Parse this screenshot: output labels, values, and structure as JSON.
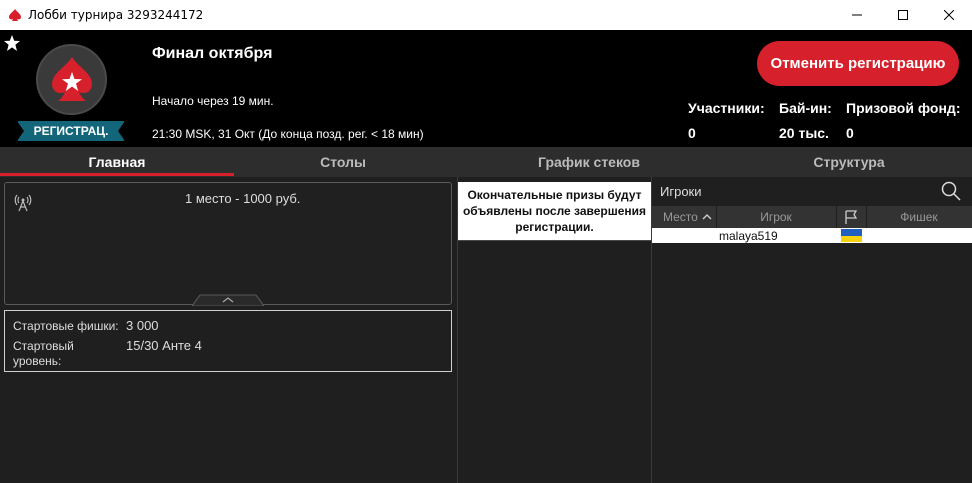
{
  "window": {
    "title": "Лобби турнира 3293244172"
  },
  "header": {
    "status_banner": "РЕГИСТРАЦ.",
    "tournament_name": "Финал октября",
    "starts_in": "Начало через 19 мин.",
    "schedule": "21:30 MSK, 31 Окт (До конца позд. рег. < 18 мин)",
    "cancel_button": "Отменить регистрацию",
    "stats": {
      "players_label": "Участники:",
      "players_value": "0",
      "buyin_label": "Бай-ин:",
      "buyin_value": "20 тыс.",
      "prizepool_label": "Призовой фонд:",
      "prizepool_value": "0"
    }
  },
  "tabs": [
    {
      "label": "Главная",
      "active": true
    },
    {
      "label": "Столы",
      "active": false
    },
    {
      "label": "График стеков",
      "active": false
    },
    {
      "label": "Структура",
      "active": false
    }
  ],
  "main": {
    "prize_line": "1 место - 1000 руб.",
    "starting_chips_label": "Стартовые фишки:",
    "starting_chips_value": "3 000",
    "starting_level_label": "Стартовый уровень:",
    "starting_level_value": "15/30 Анте 4"
  },
  "prizes": {
    "notice": "Окончательные призы будут объявлены после завершения регистрации."
  },
  "players": {
    "title": "Игроки",
    "columns": [
      "Место",
      "Игрок",
      "Фишек"
    ],
    "sort_icon": "sort-up-icon",
    "flag_column_icon": "flag-icon",
    "rows": [
      {
        "place": "",
        "player": "malaya519",
        "country_flag": "ukraine-flag",
        "chips": ""
      }
    ]
  },
  "colors": {
    "accent_red": "#d6202b",
    "banner_teal": "#13667a",
    "background": "#1f1f1f"
  }
}
